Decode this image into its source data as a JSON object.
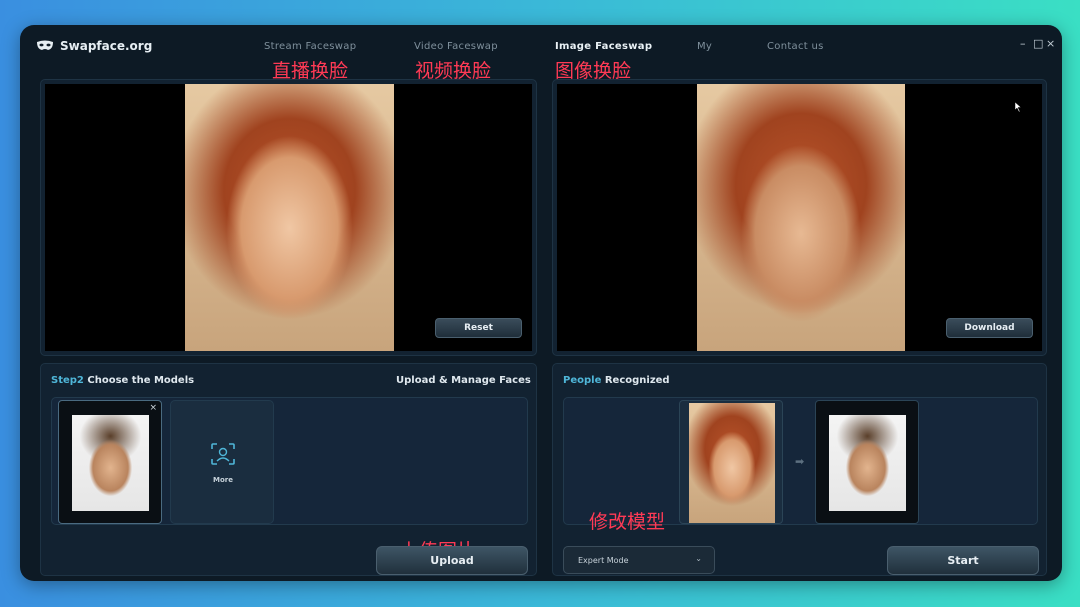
{
  "app": {
    "title": "Swapface.org"
  },
  "nav": {
    "items": [
      {
        "label": "Stream Faceswap",
        "cn": "直播换脸"
      },
      {
        "label": "Video Faceswap",
        "cn": "视频换脸"
      },
      {
        "label": "Image Faceswap",
        "cn": "图像换脸"
      },
      {
        "label": "My"
      },
      {
        "label": "Contact us"
      }
    ]
  },
  "window_controls": {
    "minimize": "–",
    "maximize": "□",
    "close": "×"
  },
  "source_viewer": {
    "reset_label": "Reset"
  },
  "result_viewer": {
    "download_label": "Download"
  },
  "models": {
    "step_label": "Step2",
    "title": "Choose the Models",
    "upload_manage": "Upload & Manage Faces",
    "more_label": "More",
    "close_symbol": "×",
    "upload_label": "Upload",
    "annotation_upload": "上传图片"
  },
  "recognized": {
    "title_accent": "People",
    "title_rest": "Recognized",
    "annotation_modify": "修改模型",
    "arrow_symbol": "➡",
    "mode_select": "Expert Mode",
    "start_label": "Start"
  }
}
